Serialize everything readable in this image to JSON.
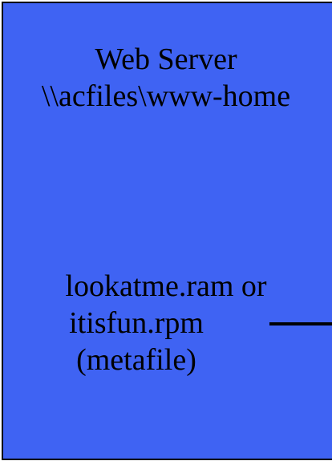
{
  "server": {
    "title": "Web Server",
    "path": "\\\\acfiles\\www-home"
  },
  "file": {
    "line1": "lookatme.ram or",
    "line2": "itisfun.rpm",
    "line3": "(metafile)"
  },
  "colors": {
    "box_fill": "#3f63f3",
    "border": "#000000",
    "text": "#000000"
  }
}
